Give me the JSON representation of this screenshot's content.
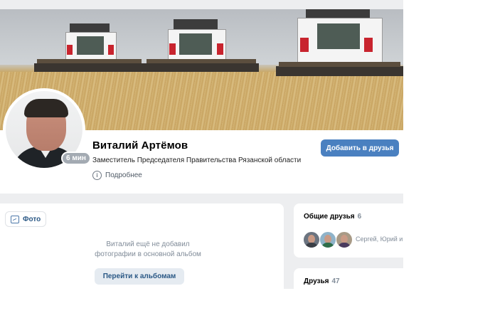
{
  "cover": {
    "description_icons": [
      "combine-harvester-icon",
      "combine-harvester-icon",
      "combine-harvester-icon"
    ]
  },
  "profile": {
    "name": "Виталий Артёмов",
    "status": "Заместитель Председателя Правительства Рязанской области",
    "more_label": "Подробнее",
    "online_badge": "6 мин",
    "add_friend_label": "Добавить в друзья"
  },
  "photos": {
    "tab_label": "Фото",
    "empty_line1": "Виталий ещё не добавил",
    "empty_line2": "фотографии в основной альбом",
    "albums_button": "Перейти к альбомам"
  },
  "mutual_friends": {
    "title": "Общие друзья",
    "count": "6",
    "names": "Сергей, Юрий и"
  },
  "friends": {
    "title": "Друзья",
    "count": "47"
  },
  "colors": {
    "accent_button": "#4a80c0",
    "link": "#2a5885",
    "page_bg": "#edeef0"
  }
}
